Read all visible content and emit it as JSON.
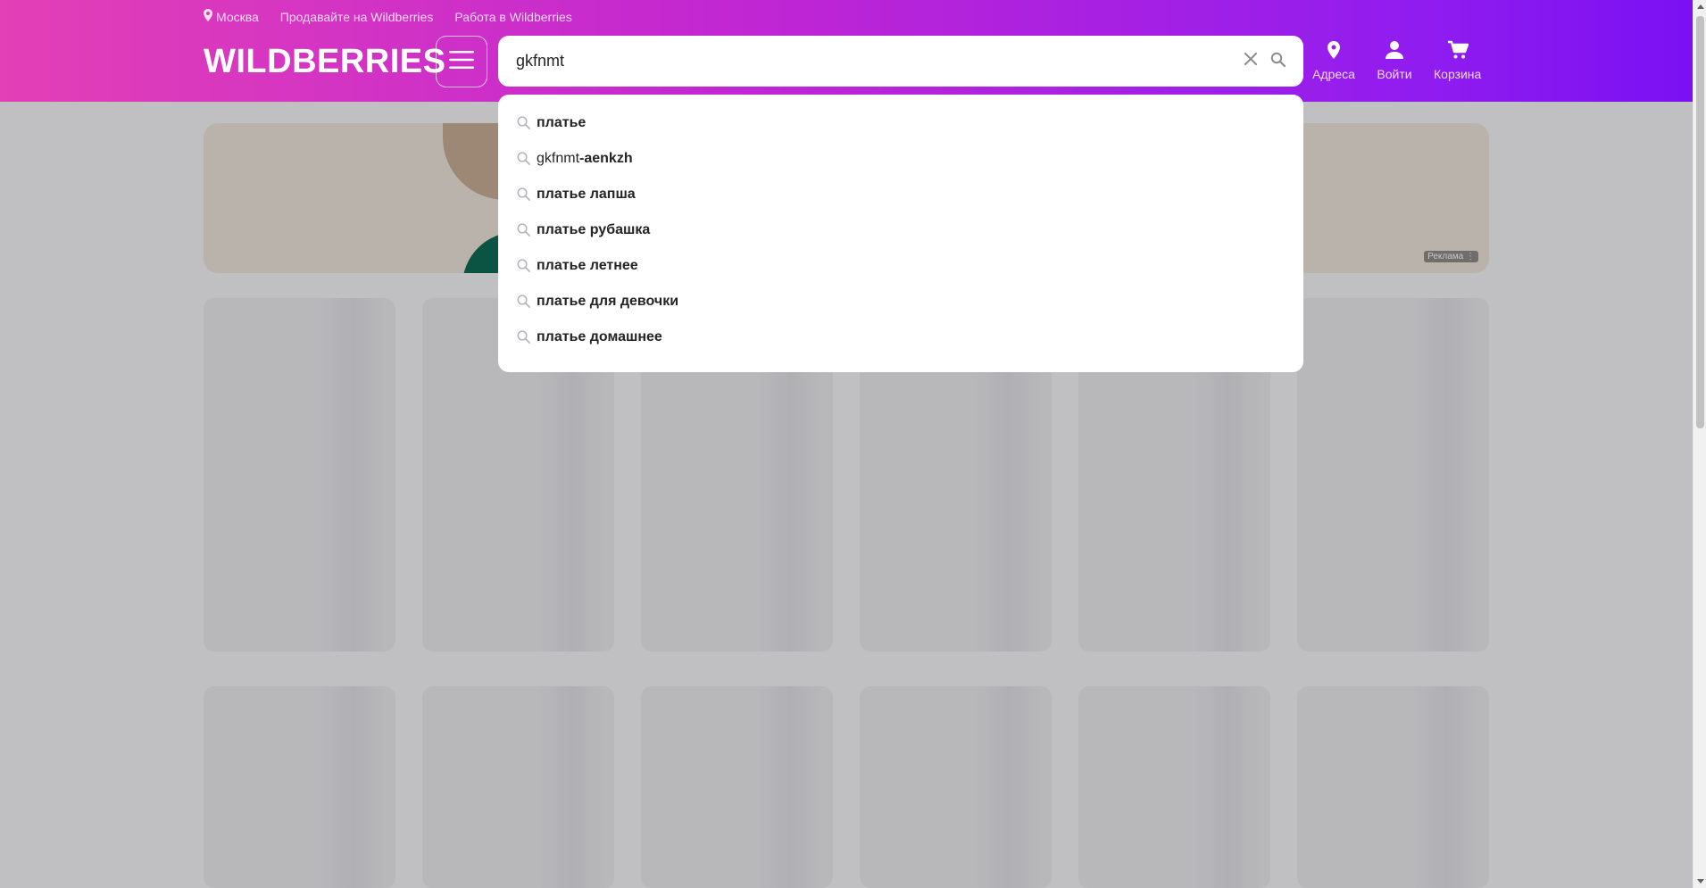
{
  "topbar": {
    "city": "Москва",
    "sell_link": "Продавайте на Wildberries",
    "jobs_link": "Работа в Wildberries"
  },
  "logo": "WILDBERRIES",
  "search": {
    "value": "gkfnmt",
    "placeholder": ""
  },
  "nav": {
    "addresses": "Адреса",
    "login": "Войти",
    "cart": "Корзина"
  },
  "banner": {
    "ad_label": "Реклама ⋮"
  },
  "suggestions": [
    {
      "plain": "",
      "bold": "платье"
    },
    {
      "plain": "gkfnmt",
      "bold": "-aenkzh"
    },
    {
      "plain": "",
      "bold": "платье лапша"
    },
    {
      "plain": "",
      "bold": "платье рубашка"
    },
    {
      "plain": "",
      "bold": "платье летнее"
    },
    {
      "plain": "",
      "bold": "платье для девочки"
    },
    {
      "plain": "",
      "bold": "платье домашнее"
    }
  ],
  "colors": {
    "header_gradient_start": "#e33fb6",
    "header_gradient_end": "#7b10f2"
  }
}
